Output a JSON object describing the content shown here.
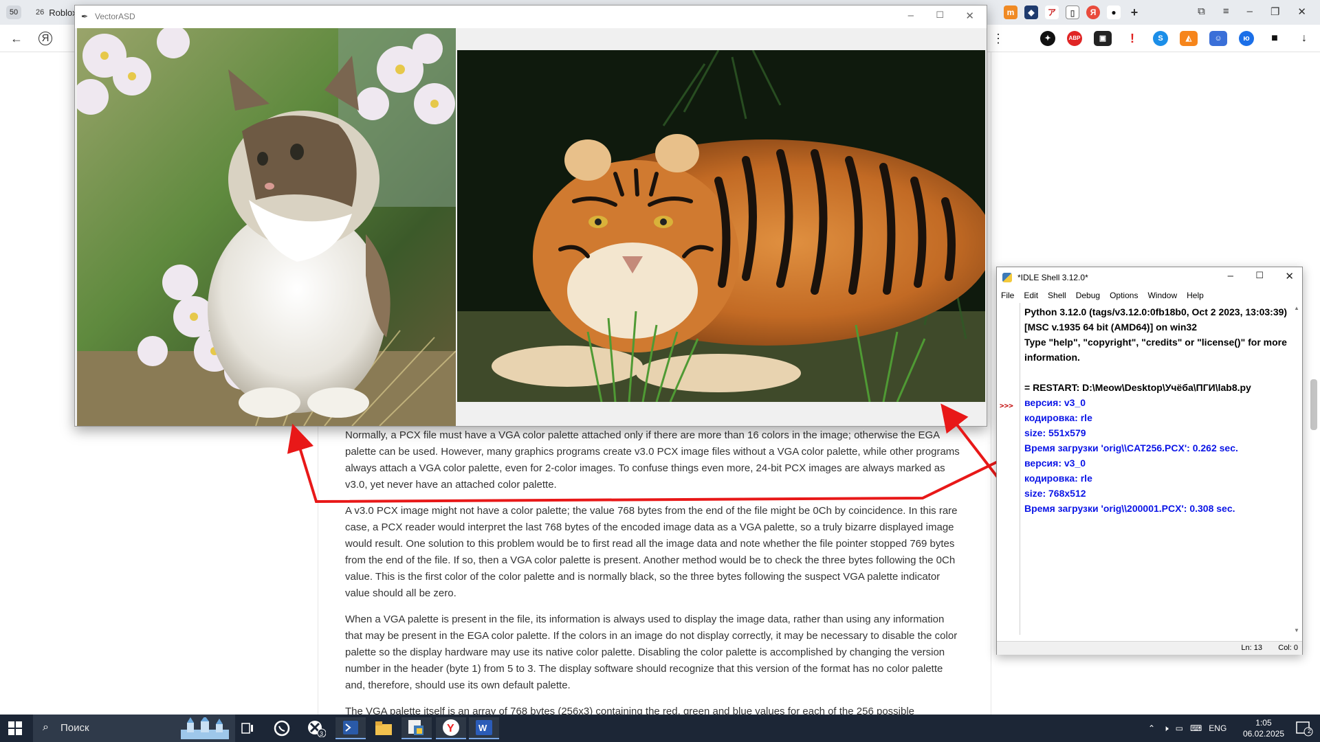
{
  "browser": {
    "tab_count": "50",
    "tabs": [
      {
        "count": "26",
        "label": "Roblox"
      }
    ]
  },
  "vector_window": {
    "title": "VectorASD"
  },
  "article": {
    "paragraphs": [
      "Normally, a PCX file must have a VGA color palette attached only if there are more than 16 colors in the image; otherwise the EGA palette can be used. However, many graphics programs create v3.0 PCX image files without a VGA color palette, while other programs always attach a VGA color palette, even for 2-color images. To confuse things even more, 24-bit PCX images are always marked as v3.0, yet never have an attached color palette.",
      "A v3.0 PCX image might not have a color palette; the value 768 bytes from the end of the file might be 0Ch by coincidence. In this rare case, a PCX reader would interpret the last 768 bytes of the encoded image data as a VGA palette, so a truly bizarre displayed image would result. One solution to this problem would be to first read all the image data and note whether the file pointer stopped 769 bytes from the end of the file. If so, then a VGA color palette is present. Another method would be to check the three bytes following the 0Ch value. This is the first color of the color palette and is normally black, so the three bytes following the suspect VGA palette indicator value should all be zero.",
      "When a VGA palette is present in the file, its information is always used to display the image data, rather than using any information that may be present in the EGA color palette. If the colors in an image do not display correctly, it may be necessary to disable the color palette so the display hardware may use its native color palette. Disabling the color palette is accomplished by changing the version number in the header (byte 1) from 5 to 3. The display software should recognize that this version of the format has no color palette and, therefore, should use its own default palette.",
      "The VGA palette itself is an array of 768 bytes (256x3) containing the red, green and blue values for each of the 256 possible"
    ]
  },
  "idle": {
    "title": "*IDLE Shell 3.12.0*",
    "menu": [
      "File",
      "Edit",
      "Shell",
      "Debug",
      "Options",
      "Window",
      "Help"
    ],
    "prompt": ">>>",
    "banner": [
      "Python 3.12.0 (tags/v3.12.0:0fb18b0, Oct  2 2023, 13:03:39) [MSC v.1935 64 bit (AMD64)] on win32",
      "Type \"help\", \"copyright\", \"credits\" or \"license()\" for more information."
    ],
    "restart": "= RESTART: D:\\Meow\\Desktop\\Учёба\\ПГИ\\lab8.py",
    "output": [
      "версия: v3_0",
      "кодировка: rle",
      "size: 551x579",
      "Время загрузки 'orig\\\\CAT256.PCX': 0.262 sec.",
      "версия: v3_0",
      "кодировка: rle",
      "size: 768x512",
      "Время загрузки 'orig\\\\200001.PCX': 0.308 sec."
    ],
    "status_ln": "Ln: 13",
    "status_col": "Col: 0"
  },
  "taskbar": {
    "search_text": "Поиск",
    "lang": "ENG",
    "time": "1:05",
    "date": "06.02.2025",
    "notification_count": "2"
  },
  "colors": {
    "arrow": "#e81818",
    "idle_output": "#0a14e6",
    "taskbar": "#1c2636"
  }
}
